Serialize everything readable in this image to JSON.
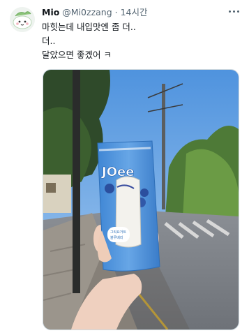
{
  "tweet": {
    "display_name": "Mio",
    "handle": "@Mi0zzang",
    "separator": "·",
    "time": "14시간",
    "text_lines": [
      "마힛는데 내입맛엔 좀 더..",
      "더..",
      "달았으면 좋겠어 ㅋ"
    ]
  },
  "product": {
    "brand_text": "JOee",
    "badge_text": "그릭요거트\n블루베리"
  },
  "icons": {
    "more": "more-horizontal-icon",
    "avatar": "avatar-character-icon"
  },
  "colors": {
    "name": "#0f1419",
    "secondary": "#536471",
    "border": "#cfd9de",
    "package_blue": "#4a8fd6",
    "sky": "#6aa8e6"
  }
}
